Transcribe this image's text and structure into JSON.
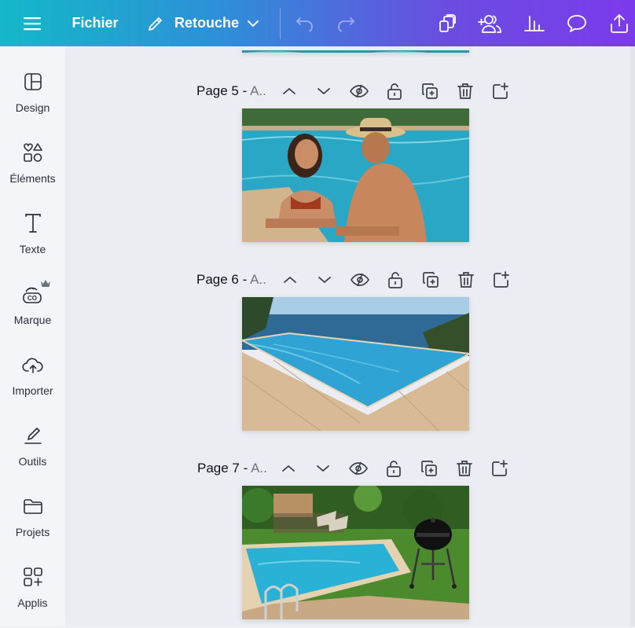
{
  "topbar": {
    "file_label": "Fichier",
    "retouch_label": "Retouche"
  },
  "sidebar": {
    "items": [
      {
        "label": "Design",
        "icon": "layout-icon"
      },
      {
        "label": "Éléments",
        "icon": "shapes-icon"
      },
      {
        "label": "Texte",
        "icon": "text-icon"
      },
      {
        "label": "Marque",
        "icon": "brand-icon"
      },
      {
        "label": "Importer",
        "icon": "cloud-upload-icon"
      },
      {
        "label": "Outils",
        "icon": "pen-icon"
      },
      {
        "label": "Projets",
        "icon": "folder-icon"
      },
      {
        "label": "Applis",
        "icon": "apps-icon"
      }
    ]
  },
  "pages": [
    {
      "title": "Page 5 - ",
      "subtitle": "A..",
      "image": "Couple smiling in a swimming pool"
    },
    {
      "title": "Page 6 - ",
      "subtitle": "A..",
      "image": "Infinity pool overlooking the sea"
    },
    {
      "title": "Page 7 - ",
      "subtitle": "A..",
      "image": "Garden pool with lounge chairs and barbecue"
    }
  ],
  "colors": {
    "topbar_start": "#14b8c8",
    "topbar_end": "#7c3aed",
    "sidebar_bg": "#f4f5f8",
    "canvas_bg": "#ebedf2",
    "pool_water": "#2aa7c4",
    "crown": "#6b7280"
  }
}
